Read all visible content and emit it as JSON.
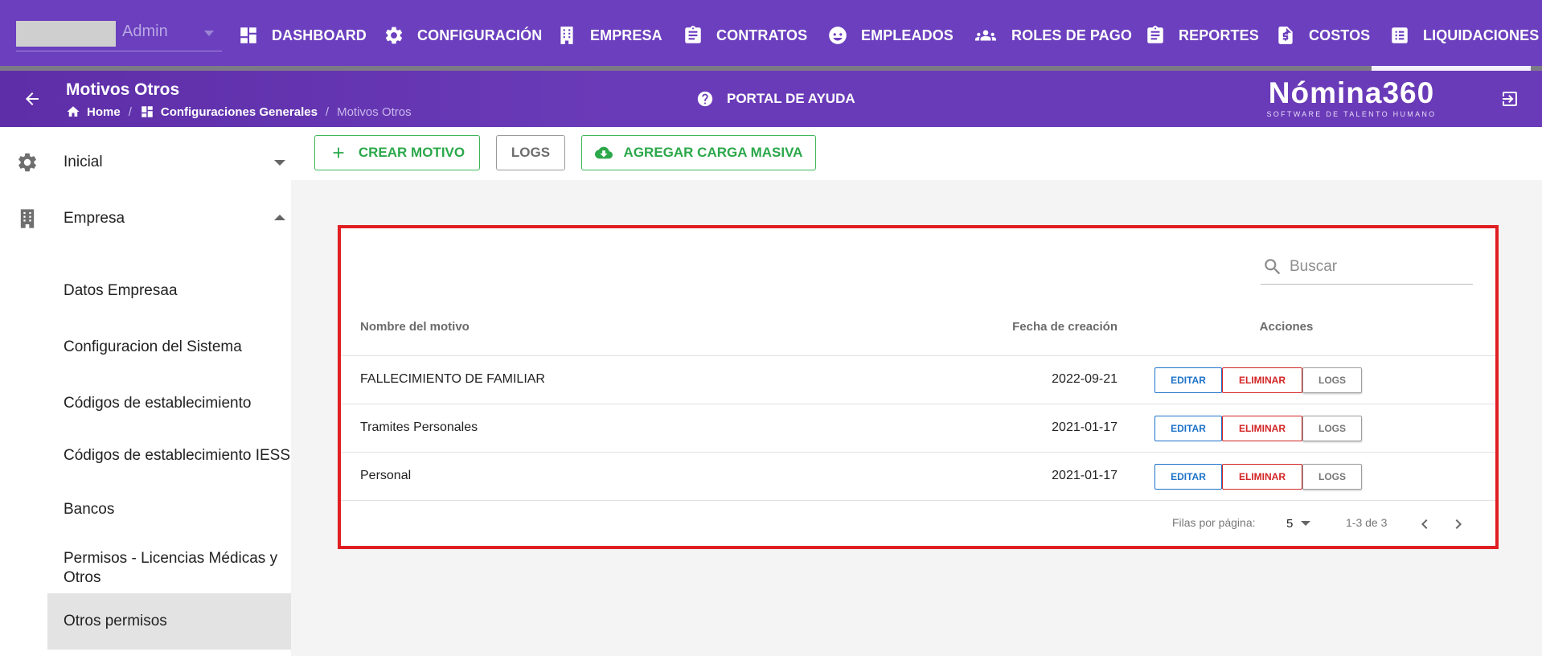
{
  "user": {
    "name": "Admin"
  },
  "nav": [
    {
      "id": "dashboard",
      "label": "DASHBOARD",
      "icon": "dashboard-icon"
    },
    {
      "id": "configuracion",
      "label": "CONFIGURACIÓN",
      "icon": "gear-icon"
    },
    {
      "id": "empresa",
      "label": "EMPRESA",
      "icon": "building-icon"
    },
    {
      "id": "contratos",
      "label": "CONTRATOS",
      "icon": "clipboard-icon"
    },
    {
      "id": "empleados",
      "label": "EMPLEADOS",
      "icon": "face-icon"
    },
    {
      "id": "roles-de-pago",
      "label": "ROLES DE PAGO",
      "icon": "group-icon"
    },
    {
      "id": "reportes",
      "label": "REPORTES",
      "icon": "clipboard-icon"
    },
    {
      "id": "costos",
      "label": "COSTOS",
      "icon": "invoice-dollar-icon"
    },
    {
      "id": "liquidaciones",
      "label": "LIQUIDACIONES",
      "icon": "list-icon",
      "active": true
    }
  ],
  "header": {
    "title": "Motivos Otros",
    "breadcrumb": [
      "Home",
      "Configuraciones Generales",
      "Motivos Otros"
    ],
    "help": "PORTAL DE AYUDA",
    "logo_main": "Nómina360",
    "logo_sub": "SOFTWARE DE TALENTO HUMANO"
  },
  "sidebar": {
    "sections": [
      {
        "label": "Inicial",
        "icon": "gear-icon",
        "expanded": false
      },
      {
        "label": "Empresa",
        "icon": "building-icon",
        "expanded": true
      }
    ],
    "items": [
      "Datos Empresaa",
      "Configuracion del Sistema",
      "Códigos de establecimiento",
      "Códigos de establecimiento IESS",
      "Bancos",
      "Permisos - Licencias Médicas y Otros",
      "Otros permisos"
    ],
    "active_item": "Otros permisos"
  },
  "toolbar": {
    "create": "CREAR MOTIVO",
    "logs": "LOGS",
    "bulk": "AGREGAR CARGA MASIVA"
  },
  "table": {
    "search_placeholder": "Buscar",
    "columns": [
      "Nombre del motivo",
      "Fecha de creación",
      "Acciones"
    ],
    "rows": [
      {
        "name": "FALLECIMIENTO DE FAMILIAR",
        "date": "2022-09-21"
      },
      {
        "name": "Tramites Personales",
        "date": "2021-01-17"
      },
      {
        "name": "Personal",
        "date": "2021-01-17"
      }
    ],
    "actions": {
      "edit": "EDITAR",
      "delete": "ELIMINAR",
      "logs": "LOGS"
    },
    "pagination": {
      "rows_per_page_label": "Filas por página:",
      "rows_per_page": "5",
      "range": "1-3 de 3"
    }
  },
  "colors": {
    "nav_bg": "#6b3fbe",
    "accent_green": "#2ba84a",
    "edit_blue": "#1e73c8",
    "delete_red": "#d32424",
    "highlight_red": "#e01e22"
  }
}
